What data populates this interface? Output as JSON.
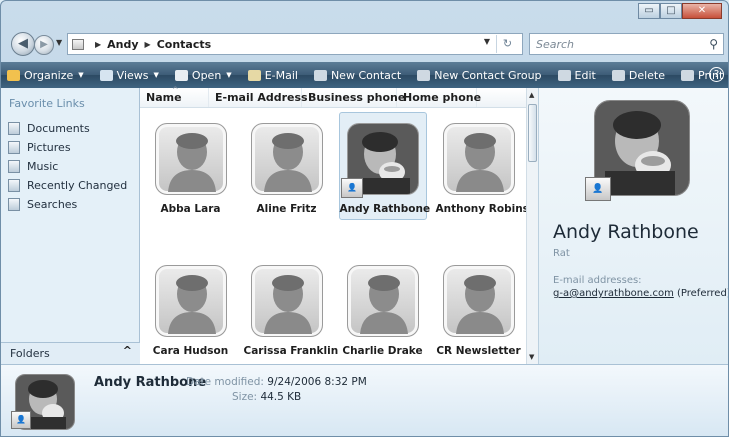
{
  "window": {
    "minimize_glyph": "▭",
    "maximize_glyph": "□",
    "close_glyph": "✕"
  },
  "address": {
    "crumbs": [
      "Andy",
      "Contacts"
    ],
    "search_placeholder": "Search"
  },
  "toolbar": {
    "items": [
      {
        "label": "Organize",
        "has_arrow": true,
        "icon": "organize-icon",
        "color": "#f2c14e"
      },
      {
        "label": "Views",
        "has_arrow": true,
        "icon": "views-icon",
        "color": "#d6e4f0"
      },
      {
        "label": "Open",
        "has_arrow": true,
        "icon": "open-icon",
        "color": "#e9eef2"
      },
      {
        "label": "E-Mail",
        "has_arrow": false,
        "icon": "email-icon",
        "color": "#e6d9a5"
      },
      {
        "label": "New Contact",
        "has_arrow": false,
        "icon": "new-contact-icon",
        "color": "#cfd9e2"
      },
      {
        "label": "New Contact Group",
        "has_arrow": false,
        "icon": "new-contact-group-icon",
        "color": "#cfd9e2"
      },
      {
        "label": "Edit",
        "has_arrow": false,
        "icon": "edit-icon",
        "color": "#cfd9e2"
      },
      {
        "label": "Delete",
        "has_arrow": false,
        "icon": "delete-icon",
        "color": "#cfd9e2"
      },
      {
        "label": "Print",
        "has_arrow": false,
        "icon": "print-icon",
        "color": "#cfd9e2"
      }
    ],
    "overflow": "»",
    "help": "?"
  },
  "nav": {
    "title": "Favorite Links",
    "items": [
      {
        "label": "Documents",
        "icon": "documents-icon"
      },
      {
        "label": "Pictures",
        "icon": "pictures-icon"
      },
      {
        "label": "Music",
        "icon": "music-icon"
      },
      {
        "label": "Recently Changed",
        "icon": "recently-changed-icon"
      },
      {
        "label": "Searches",
        "icon": "searches-icon"
      }
    ],
    "folders_label": "Folders",
    "folders_chevron": "^"
  },
  "columns": [
    "Name",
    "E-mail Address",
    "Business phone",
    "Home phone"
  ],
  "contacts": [
    {
      "name": "Abba Lara",
      "photo": "placeholder",
      "selected": false
    },
    {
      "name": "Aline Fritz",
      "photo": "placeholder",
      "selected": false
    },
    {
      "name": "Andy Rathbone",
      "photo": "real",
      "selected": true
    },
    {
      "name": "Anthony Robinson",
      "photo": "placeholder",
      "selected": false
    },
    {
      "name": "Cara Hudson",
      "photo": "placeholder",
      "selected": false
    },
    {
      "name": "Carissa Franklin",
      "photo": "placeholder",
      "selected": false
    },
    {
      "name": "Charlie Drake",
      "photo": "placeholder",
      "selected": false
    },
    {
      "name": "CR Newsletter",
      "photo": "placeholder",
      "selected": false
    }
  ],
  "preview": {
    "name": "Andy Rathbone",
    "nickname": "Rat",
    "email_label": "E-mail addresses:",
    "email": "g-a@andyrathbone.com",
    "email_suffix": "(Preferred)"
  },
  "details": {
    "name": "Andy Rathbone",
    "date_label": "Date modified:",
    "date_value": "9/24/2006 8:32 PM",
    "size_label": "Size:",
    "size_value": "44.5 KB"
  }
}
